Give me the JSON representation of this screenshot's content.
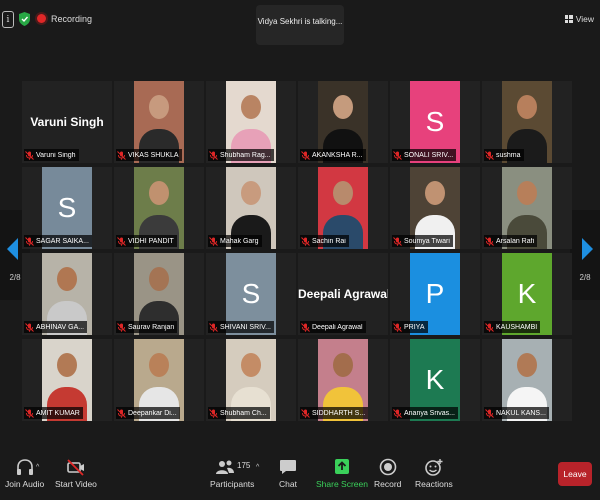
{
  "recording": {
    "label": "Recording"
  },
  "talking": {
    "text": "Vidya Sekhri is talking..."
  },
  "view": {
    "label": "View"
  },
  "pager": {
    "left_page": "2/8",
    "right_page": "2/8"
  },
  "colors": {
    "accent": "#1e8fe1",
    "leave": "#b8232a",
    "share": "#3ad05a",
    "muted": "#e02727"
  },
  "participants": [
    {
      "name": "Varuni Singh",
      "kind": "name"
    },
    {
      "name": "VIKAS SHUKLA",
      "kind": "photo",
      "bg": "#a86a54",
      "skin": "#c79a7e",
      "shirt": "#2a2a2a"
    },
    {
      "name": "Shubham Rag...",
      "kind": "photo",
      "bg": "#e4d9cf",
      "skin": "#b98463",
      "shirt": "#e7a1b8"
    },
    {
      "name": "AKANKSHA R...",
      "kind": "photo",
      "bg": "#3a3228",
      "skin": "#c59b7d",
      "shirt": "#111111"
    },
    {
      "name": "SONALI SRIV...",
      "kind": "letter",
      "letter": "S",
      "bg": "#e7417c"
    },
    {
      "name": "sushma",
      "kind": "photo",
      "bg": "#5b4a33",
      "skin": "#b77f5c",
      "shirt": "#1b1b1b"
    },
    {
      "name": "SAGAR SAIKA...",
      "kind": "letter",
      "letter": "S",
      "bg": "#778a9a"
    },
    {
      "name": "VIDHI PANDIT",
      "kind": "photo",
      "bg": "#6d7d4a",
      "skin": "#c0916f",
      "shirt": "#3b3b3b"
    },
    {
      "name": "Mahak Garg",
      "kind": "photo",
      "bg": "#cfc7bc",
      "skin": "#c89b7e",
      "shirt": "#1a1a1a"
    },
    {
      "name": "Sachin Rai",
      "kind": "photo",
      "bg": "#d23842",
      "skin": "#b88a6c",
      "shirt": "#2a4a6a"
    },
    {
      "name": "Soumya Tiwari",
      "kind": "photo",
      "bg": "#4e4336",
      "skin": "#c09272",
      "shirt": "#f0f0f0"
    },
    {
      "name": "Arsalan Rafi",
      "kind": "photo",
      "bg": "#8a8f80",
      "skin": "#b77f5a",
      "shirt": "#4a4a3a"
    },
    {
      "name": "ABHINAV GA...",
      "kind": "photo",
      "bg": "#b7b3a8",
      "skin": "#b07752",
      "shirt": "#c9c9c9"
    },
    {
      "name": "Saurav Ranjan",
      "kind": "photo",
      "bg": "#9a9486",
      "skin": "#a47454",
      "shirt": "#2e2e2e"
    },
    {
      "name": "SHIVANI SRIV...",
      "kind": "letter",
      "letter": "S",
      "bg": "#7d8f9d"
    },
    {
      "name": "Deepali Agrawal",
      "kind": "name"
    },
    {
      "name": "PRIYA",
      "kind": "letter",
      "letter": "P",
      "bg": "#1b8fe0"
    },
    {
      "name": "KAUSHAMBI",
      "kind": "letter",
      "letter": "K",
      "bg": "#5ea72d"
    },
    {
      "name": "AMIT KUMAR",
      "kind": "photo",
      "bg": "#d9d4cb",
      "skin": "#b27a55",
      "shirt": "#c53a32"
    },
    {
      "name": "Deepankar Di...",
      "kind": "photo",
      "bg": "#b9a98d",
      "skin": "#b98159",
      "shirt": "#e6e6e6"
    },
    {
      "name": "Shubham Ch...",
      "kind": "photo",
      "bg": "#d5ccbe",
      "skin": "#c48c66",
      "shirt": "#e7e0d2"
    },
    {
      "name": "SIDDHARTH S...",
      "kind": "photo",
      "bg": "#c47f8c",
      "skin": "#a36d4c",
      "shirt": "#f1c33a"
    },
    {
      "name": "Ananya Srivas...",
      "kind": "letter",
      "letter": "K",
      "bg": "#1d7a52"
    },
    {
      "name": "NAKUL KANS...",
      "kind": "photo",
      "bg": "#a7b0b3",
      "skin": "#b07a56",
      "shirt": "#f5f5f5"
    }
  ],
  "toolbar": {
    "join_audio": "Join Audio",
    "start_video": "Start Video",
    "participants": "Participants",
    "participants_count": "175",
    "chat": "Chat",
    "share_screen": "Share Screen",
    "record": "Record",
    "reactions": "Reactions",
    "leave": "Leave"
  }
}
